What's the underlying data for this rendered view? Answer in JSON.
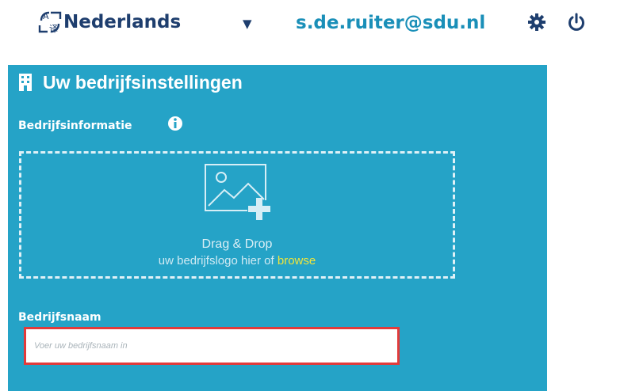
{
  "header": {
    "language": "Nederlands",
    "language_caret": "▼",
    "user_email": "s.de.ruiter@sdu.nl"
  },
  "panel": {
    "title": "Uw bedrijfsinstellingen",
    "section_label": "Bedrijfsinformatie",
    "dropzone": {
      "title": "Drag & Drop",
      "subtitle_prefix": "uw bedrijfslogo hier of ",
      "browse_label": "browse"
    },
    "company_name": {
      "label": "Bedrijfsnaam",
      "placeholder": "Voer uw bedrijfsnaam in",
      "value": ""
    }
  },
  "colors": {
    "panel_bg": "#25a3c7",
    "header_text": "#1e3e6e",
    "email_text": "#1a8fb8",
    "browse_link": "#f2e53a",
    "input_border_error": "#e23b3b"
  },
  "icons": {
    "language": "language-icon",
    "settings": "gear-icon",
    "logout": "power-icon",
    "building": "building-icon",
    "info": "info-icon",
    "upload": "image-add-icon"
  }
}
